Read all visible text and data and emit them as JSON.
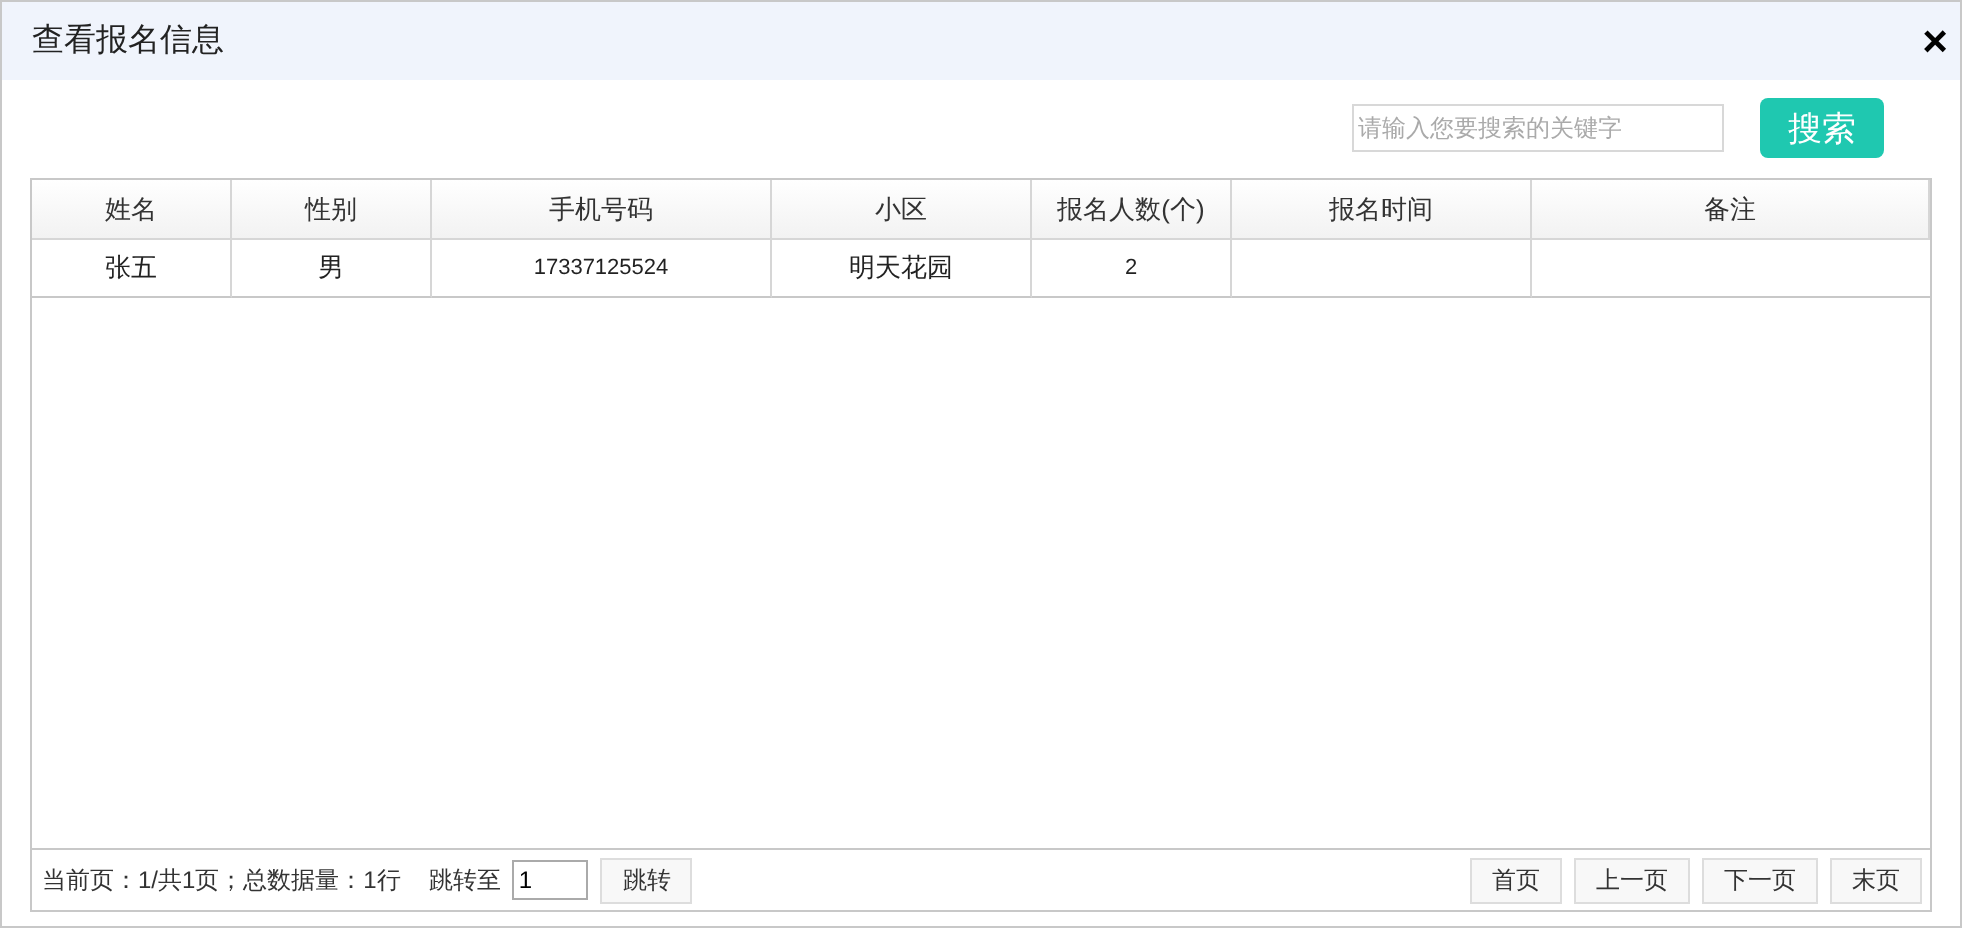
{
  "window": {
    "title": "查看报名信息",
    "close": "×"
  },
  "search": {
    "placeholder": "请输入您要搜索的关键字",
    "button": "搜索"
  },
  "table": {
    "columns": [
      "姓名",
      "性别",
      "手机号码",
      "小区",
      "报名人数(个)",
      "报名时间",
      "备注"
    ],
    "rows": [
      [
        "张五",
        "男",
        "17337125524",
        "明天花园",
        "2",
        "",
        ""
      ]
    ]
  },
  "pager": {
    "info": "当前页：1/共1页；总数据量：1行",
    "jump_label": "跳转至",
    "jump_value": "1",
    "jump_button": "跳转",
    "buttons": [
      "首页",
      "上一页",
      "下一页",
      "末页"
    ]
  }
}
